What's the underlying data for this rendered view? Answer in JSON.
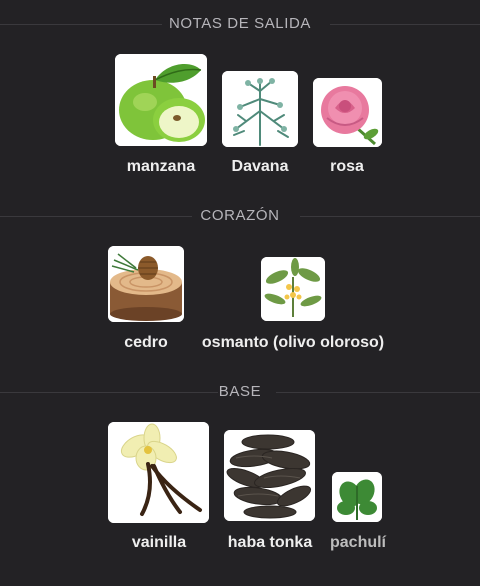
{
  "sections": [
    {
      "title": "NOTAS DE SALIDA",
      "notes": [
        {
          "name": "manzana",
          "icon": "green-apple-image"
        },
        {
          "name": "Davana",
          "icon": "davana-herb-image"
        },
        {
          "name": "rosa",
          "icon": "pink-rose-image"
        }
      ]
    },
    {
      "title": "CORAZÓN",
      "notes": [
        {
          "name": "cedro",
          "icon": "cedar-wood-image"
        },
        {
          "name": "osmanto (olivo oloroso)",
          "icon": "osmanthus-flower-image"
        }
      ]
    },
    {
      "title": "BASE",
      "notes": [
        {
          "name": "vainilla",
          "icon": "vanilla-image"
        },
        {
          "name": "haba tonka",
          "icon": "tonka-bean-image"
        },
        {
          "name": "pachulí",
          "icon": "patchouli-leaf-image"
        }
      ]
    }
  ]
}
